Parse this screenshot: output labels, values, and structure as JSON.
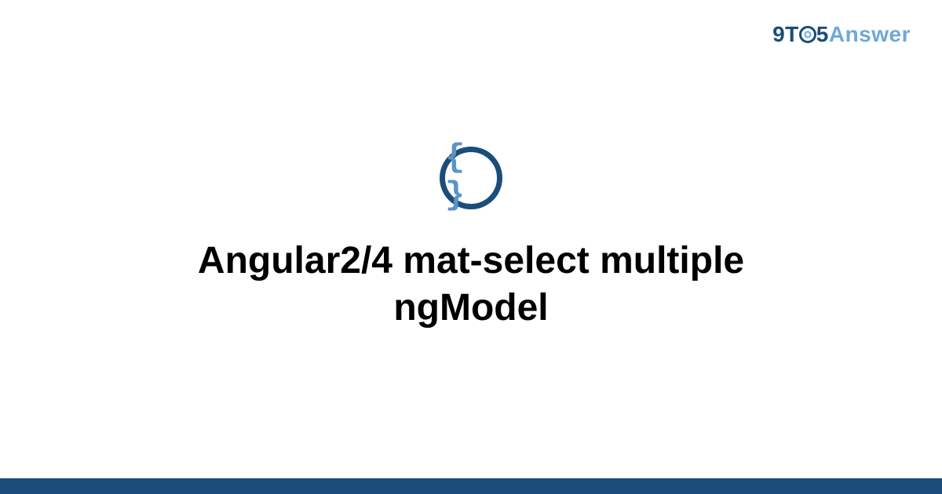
{
  "logo": {
    "part1": "9T",
    "part2": "5",
    "part3": "Answer"
  },
  "icon": {
    "glyph": "{ }"
  },
  "title": "Angular2/4 mat-select multiple ngModel",
  "colors": {
    "brand_dark": "#1a4d7a",
    "brand_light": "#6fa8d6"
  }
}
